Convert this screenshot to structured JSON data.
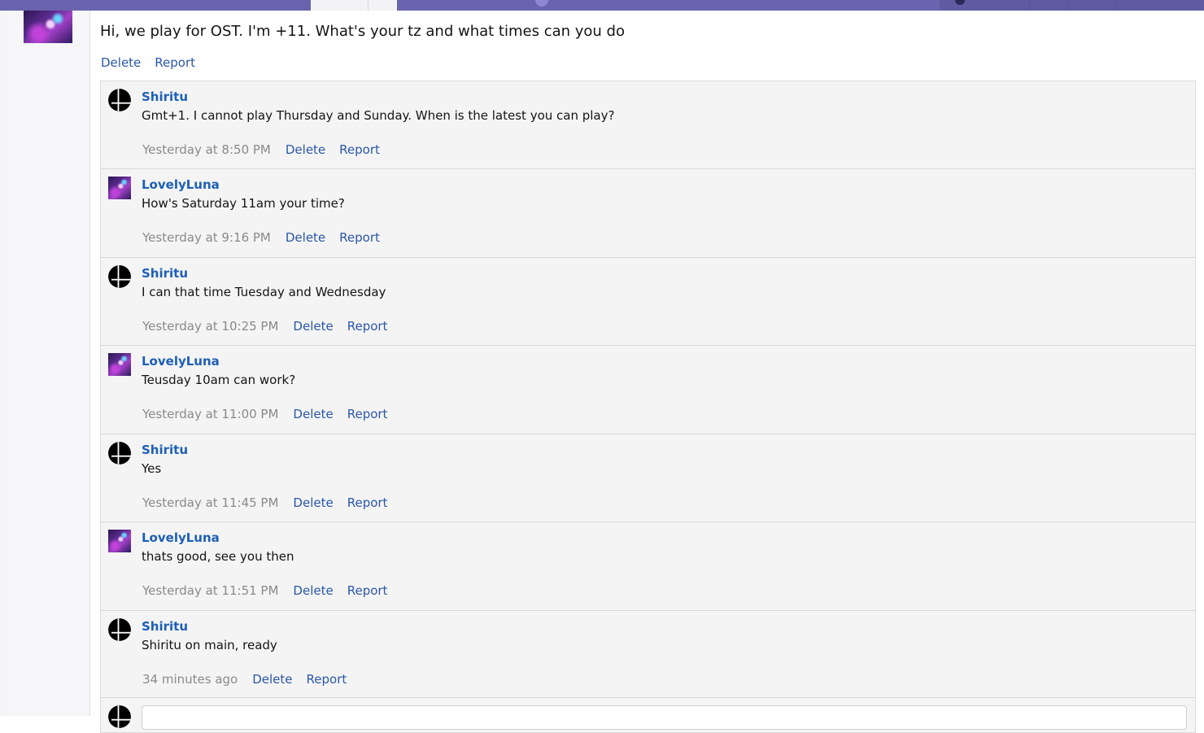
{
  "post": {
    "text": "Hi, we play for OST. I'm +11. What's your tz and what times can you do",
    "actions": {
      "delete": "Delete",
      "report": "Report"
    }
  },
  "replies": [
    {
      "author": "Shiritu",
      "avatar": "smash-logo-icon",
      "text": "Gmt+1. I cannot play Thursday and Sunday. When is the latest you can play?",
      "time": "Yesterday at 8:50 PM",
      "delete": "Delete",
      "report": "Report"
    },
    {
      "author": "LovelyLuna",
      "avatar": "anime-avatar",
      "text": "How's Saturday 11am your time?",
      "time": "Yesterday at 9:16 PM",
      "delete": "Delete",
      "report": "Report"
    },
    {
      "author": "Shiritu",
      "avatar": "smash-logo-icon",
      "text": "I can that time Tuesday and Wednesday",
      "time": "Yesterday at 10:25 PM",
      "delete": "Delete",
      "report": "Report"
    },
    {
      "author": "LovelyLuna",
      "avatar": "anime-avatar",
      "text": "Teusday 10am can work?",
      "time": "Yesterday at 11:00 PM",
      "delete": "Delete",
      "report": "Report"
    },
    {
      "author": "Shiritu",
      "avatar": "smash-logo-icon",
      "text": "Yes",
      "time": "Yesterday at 11:45 PM",
      "delete": "Delete",
      "report": "Report"
    },
    {
      "author": "LovelyLuna",
      "avatar": "anime-avatar",
      "text": "thats good, see you then",
      "time": "Yesterday at 11:51 PM",
      "delete": "Delete",
      "report": "Report"
    },
    {
      "author": "Shiritu",
      "avatar": "smash-logo-icon",
      "text": "Shiritu on main, ready",
      "time": "34 minutes ago",
      "delete": "Delete",
      "report": "Report"
    }
  ],
  "colors": {
    "nav": "#6a63ad",
    "link": "#2a57a8",
    "username": "#1d5fb8",
    "timestamp": "#8a8a8a",
    "reply_bg": "#f4f4f4"
  }
}
